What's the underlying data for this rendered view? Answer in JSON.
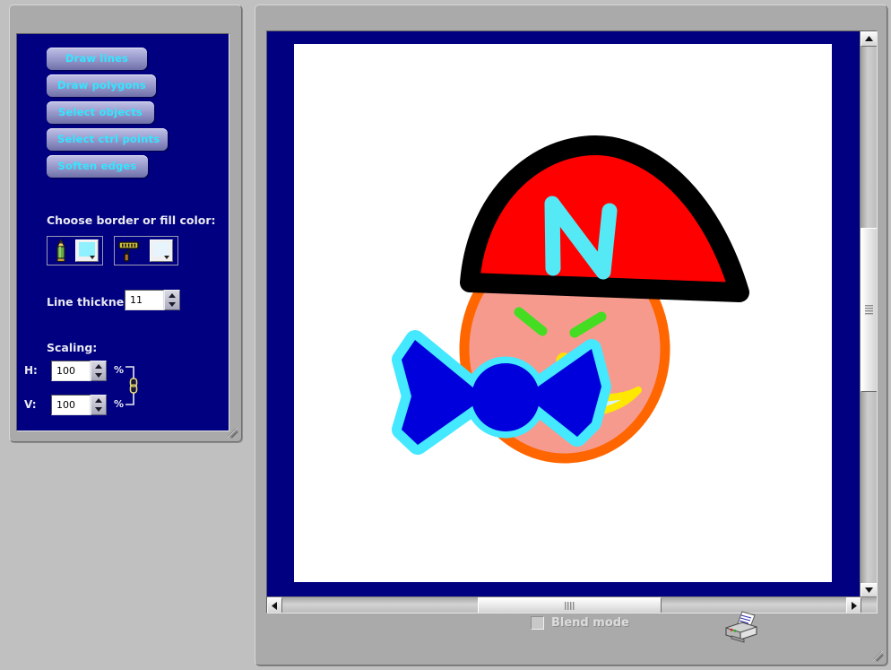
{
  "window": {
    "background_color": "#c0c0c0"
  },
  "tool_panel": {
    "background_color": "#000080",
    "buttons": [
      {
        "id": "draw-lines",
        "label": "Draw lines"
      },
      {
        "id": "draw-polygons",
        "label": "Draw polygons"
      },
      {
        "id": "select-objects",
        "label": "Select objects"
      },
      {
        "id": "select-ctrl",
        "label": "Select ctrl points"
      },
      {
        "id": "soften-edges",
        "label": "Soften edges"
      }
    ],
    "color_section": {
      "label": "Choose border or fill color:",
      "border_tool": {
        "icon": "pencil-icon",
        "swatch_color": "#8ff0ff"
      },
      "fill_tool": {
        "icon": "paint-roller-icon",
        "swatch_color": "#e8f4fb"
      }
    },
    "line_thickness": {
      "label": "Line thickness:",
      "value": "11"
    },
    "scaling": {
      "label": "Scaling:",
      "horizontal": {
        "label": "H:",
        "value": "100",
        "unit": "%"
      },
      "vertical": {
        "label": "V:",
        "value": "100",
        "unit": "%"
      },
      "link_icon": "chain-link-icon"
    }
  },
  "canvas_panel": {
    "canvas_background": "#000080",
    "paper_color": "#ffffff",
    "vertical_scrollbar": {
      "up_icon": "scroll-up-arrow-icon",
      "down_icon": "scroll-down-arrow-icon"
    },
    "horizontal_scrollbar": {
      "left_icon": "scroll-left-arrow-icon",
      "right_icon": "scroll-right-arrow-icon"
    }
  },
  "footer": {
    "blend_mode": {
      "label": "Blend mode",
      "checked": false,
      "enabled": false
    },
    "print_button": {
      "icon": "printer-icon"
    }
  },
  "artwork": {
    "title": "Face with pointed hat and bow tie",
    "colors": {
      "hat_fill": "#ff0000",
      "hat_outline": "#000000",
      "hat_letter": "#55e8f5",
      "face_fill": "#f79a8e",
      "face_outline": "#ff6600",
      "eyes": "#44dd22",
      "nose": "#ffe000",
      "mouth_outline": "#ffe800",
      "mouth_fill": "#d6f4fa",
      "bow_fill": "#0000dd",
      "bow_outline": "#44e8ff"
    }
  }
}
